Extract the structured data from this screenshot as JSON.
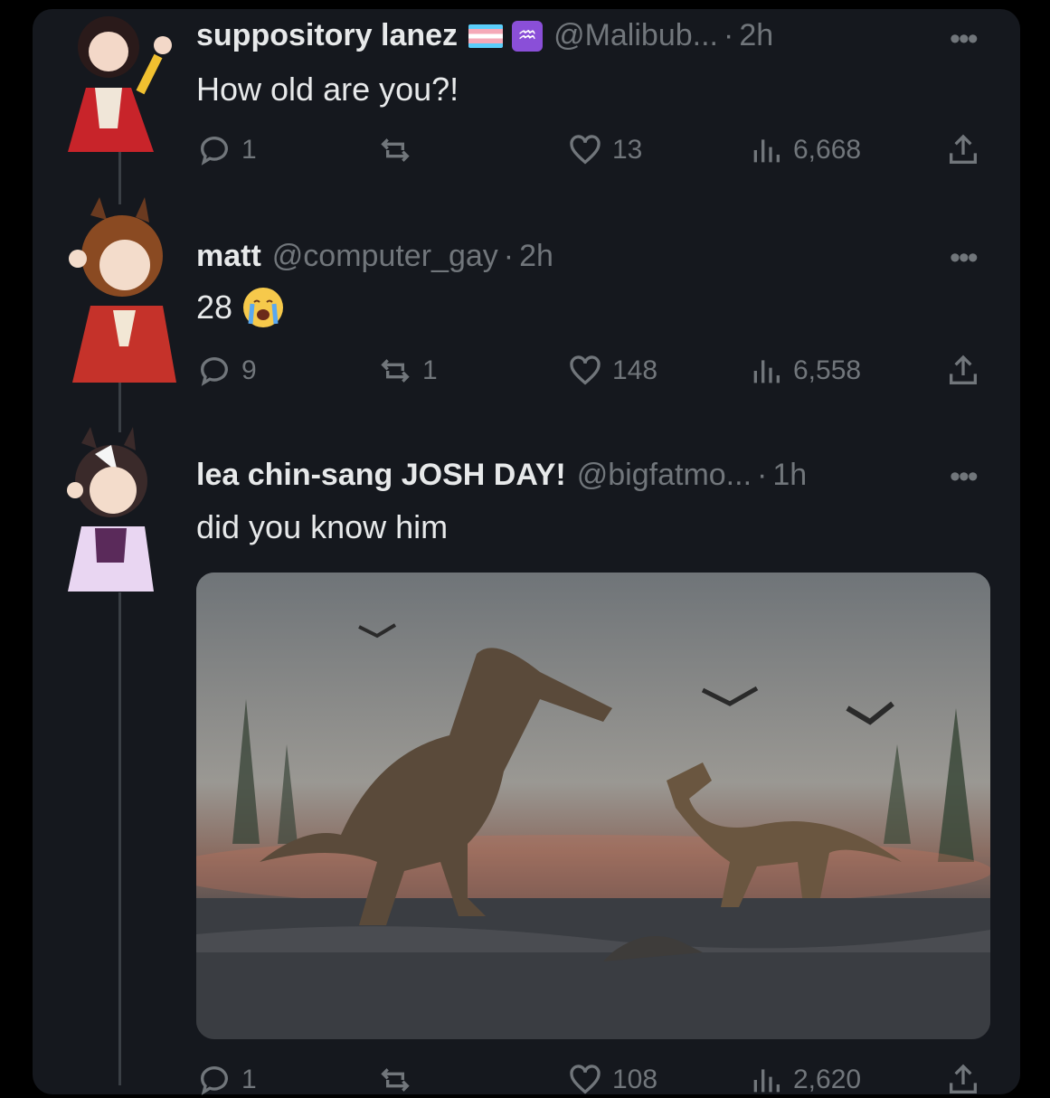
{
  "tweets": [
    {
      "display_name": "suppository lanez",
      "handle": "@Malibub...",
      "time": "2h",
      "text": "How old are you?!",
      "replies": "1",
      "reposts": "",
      "likes": "13",
      "views": "6,668"
    },
    {
      "display_name": "matt",
      "handle": "@computer_gay",
      "time": "2h",
      "text": "28",
      "emoji": "loudly-crying-face",
      "replies": "9",
      "reposts": "1",
      "likes": "148",
      "views": "6,558"
    },
    {
      "display_name": "lea chin-sang JOSH DAY!",
      "handle": "@bigfatmo...",
      "time": "1h",
      "text": "did you know him",
      "media": "dinosaur-illustration",
      "replies": "1",
      "reposts": "",
      "likes": "108",
      "views": "2,620"
    }
  ],
  "separator": "·",
  "more_label": "•••",
  "zodiac_symbol": "♒",
  "colors": {
    "background": "#15181e",
    "text": "#e7e9ea",
    "muted": "#71767b"
  }
}
